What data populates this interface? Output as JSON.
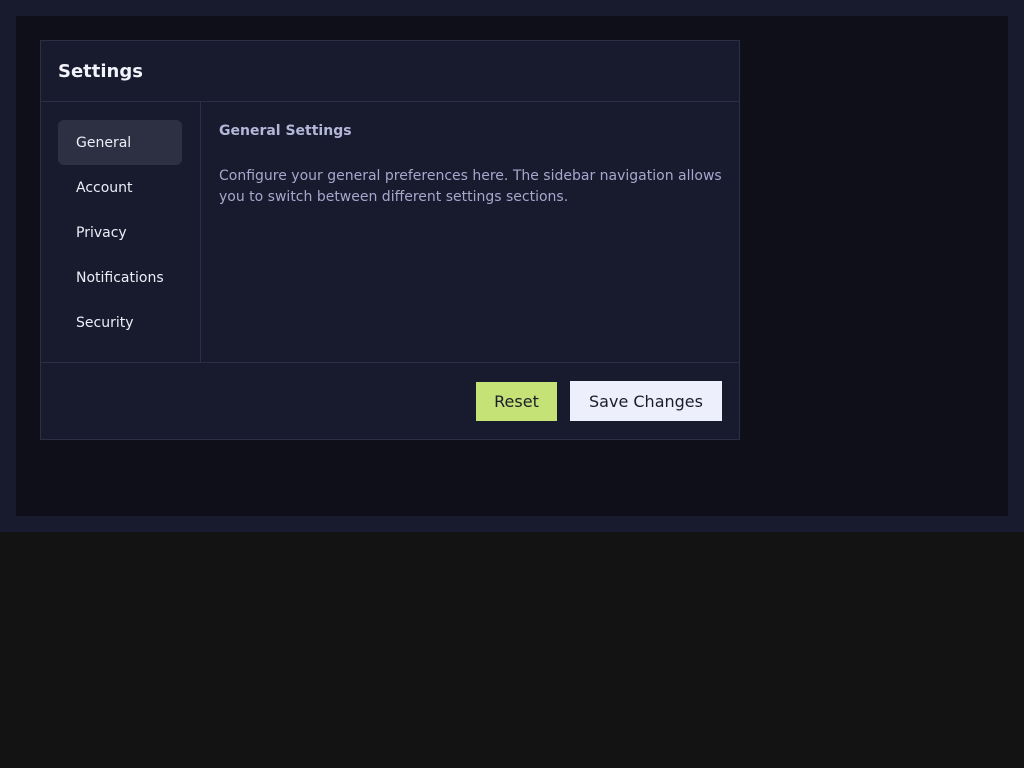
{
  "panel": {
    "title": "Settings"
  },
  "sidebar": {
    "items": [
      {
        "label": "General",
        "active": true
      },
      {
        "label": "Account",
        "active": false
      },
      {
        "label": "Privacy",
        "active": false
      },
      {
        "label": "Notifications",
        "active": false
      },
      {
        "label": "Security",
        "active": false
      }
    ]
  },
  "content": {
    "heading": "General Settings",
    "description": "Configure your general preferences here. The sidebar navigation allows you to switch between different settings sections."
  },
  "footer": {
    "reset_label": "Reset",
    "save_label": "Save Changes"
  },
  "colors": {
    "accent": "#c4e276",
    "background": "#0f0f1a",
    "panel": "#181b2e"
  }
}
